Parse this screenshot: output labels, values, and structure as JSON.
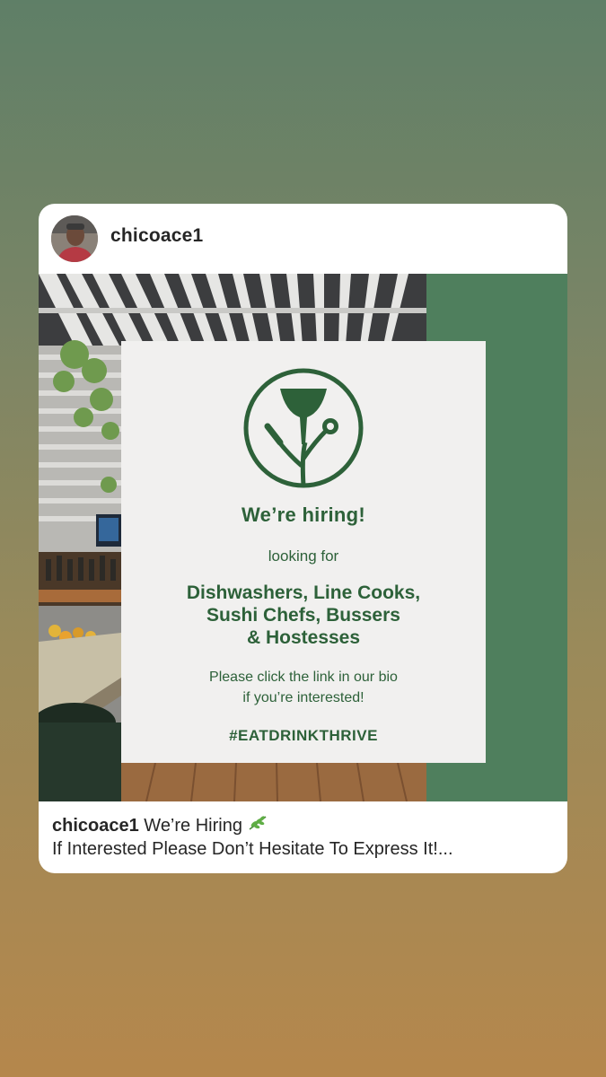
{
  "post": {
    "username": "chicoace1",
    "caption_title": "We’re Hiring",
    "caption_emoji_icon": "herb-icon",
    "caption_line2": "If Interested Please Don’t Hesitate To Express It!..."
  },
  "flyer": {
    "headline": "We’re hiring!",
    "subheadline": "looking for",
    "roles_line1": "Dishwashers, Line Cooks,",
    "roles_line2": "Sushi Chefs, Bussers",
    "roles_line3": "& Hostesses",
    "note_line1": "Please click the link in our bio",
    "note_line2": "if you’re interested!",
    "hashtag": "#EATDRINKTHRIVE"
  },
  "colors": {
    "brand_green": "#2d6139",
    "panel_green": "#4f7f5d",
    "flyer_bg": "#f1f0ef",
    "text_dark": "#262626"
  }
}
